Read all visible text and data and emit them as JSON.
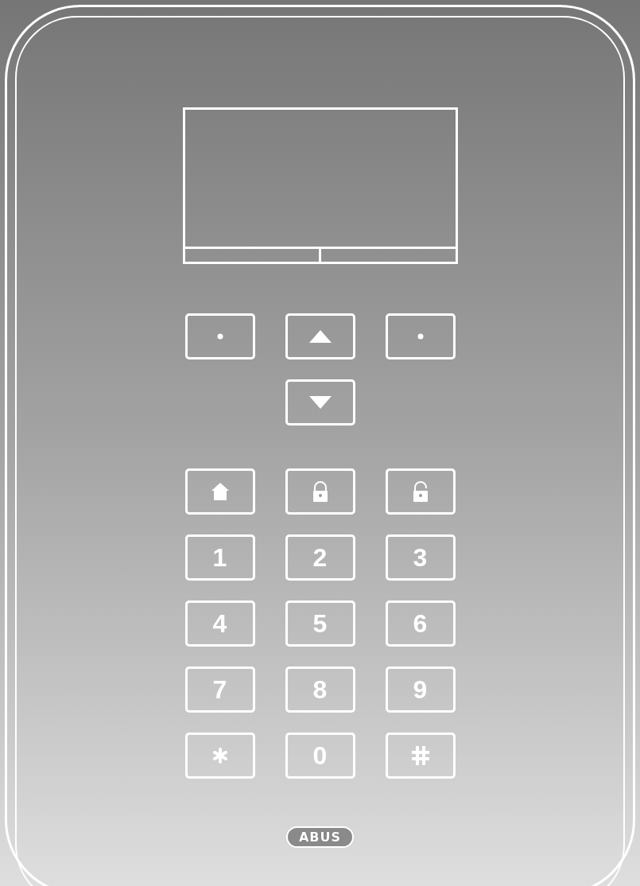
{
  "nav_keys": [
    [
      {
        "kind": "dot"
      },
      {
        "kind": "up"
      },
      {
        "kind": "dot"
      }
    ],
    [
      {
        "kind": "down"
      }
    ]
  ],
  "keypad": [
    {
      "kind": "home"
    },
    {
      "kind": "lock"
    },
    {
      "kind": "unlock"
    },
    {
      "kind": "text",
      "label": "1"
    },
    {
      "kind": "text",
      "label": "2"
    },
    {
      "kind": "text",
      "label": "3"
    },
    {
      "kind": "text",
      "label": "4"
    },
    {
      "kind": "text",
      "label": "5"
    },
    {
      "kind": "text",
      "label": "6"
    },
    {
      "kind": "text",
      "label": "7"
    },
    {
      "kind": "text",
      "label": "8"
    },
    {
      "kind": "text",
      "label": "9"
    },
    {
      "kind": "star"
    },
    {
      "kind": "text",
      "label": "0"
    },
    {
      "kind": "hash"
    }
  ],
  "logo": "ABUS"
}
